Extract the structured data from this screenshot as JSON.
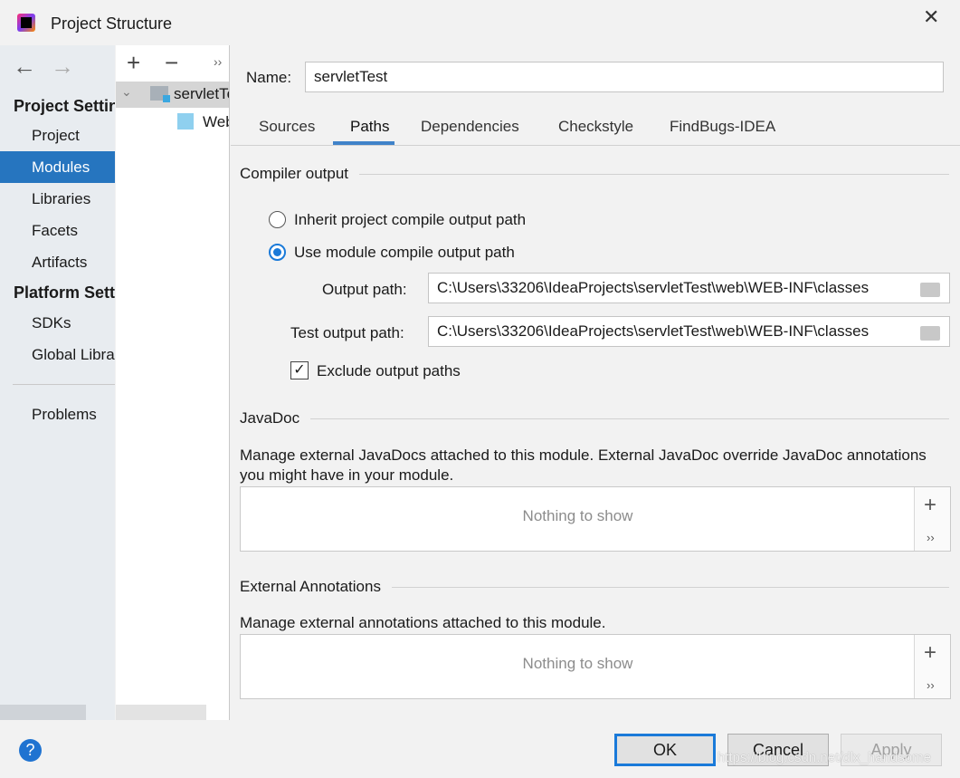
{
  "window": {
    "title": "Project Structure",
    "close_icon": "close-icon"
  },
  "sidebar": {
    "back": "←",
    "forward": "→",
    "section1": "Project Settings",
    "items1": [
      {
        "label": "Project"
      },
      {
        "label": "Modules",
        "selected": true
      },
      {
        "label": "Libraries"
      },
      {
        "label": "Facets"
      },
      {
        "label": "Artifacts"
      }
    ],
    "section2": "Platform Settings",
    "items2": [
      {
        "label": "SDKs"
      },
      {
        "label": "Global Libraries"
      }
    ],
    "problems": "Problems"
  },
  "tree": {
    "add": "+",
    "remove": "−",
    "more": "››",
    "items": [
      {
        "label": "servletTest",
        "expanded": true
      },
      {
        "label": "Web"
      }
    ]
  },
  "main": {
    "name_label": "Name:",
    "name_value": "servletTest",
    "tabs": [
      {
        "label": "Sources"
      },
      {
        "label": "Paths",
        "active": true
      },
      {
        "label": "Dependencies"
      },
      {
        "label": "Checkstyle"
      },
      {
        "label": "FindBugs-IDEA"
      }
    ],
    "compiler": {
      "title": "Compiler output",
      "inherit": "Inherit project compile output path",
      "inherit_selected": false,
      "use_module": "Use module compile output path",
      "use_module_selected": true,
      "output_label": "Output path:",
      "output_value": "C:\\Users\\33206\\IdeaProjects\\servletTest\\web\\WEB-INF\\classes",
      "test_label": "Test output path:",
      "test_value": "C:\\Users\\33206\\IdeaProjects\\servletTest\\web\\WEB-INF\\classes",
      "exclude": "Exclude output paths",
      "exclude_checked": true
    },
    "javadoc": {
      "title": "JavaDoc",
      "desc": "Manage external JavaDocs attached to this module. External JavaDoc override JavaDoc annotations you might have in your module.",
      "empty": "Nothing to show",
      "add": "+",
      "more": "››"
    },
    "annotations": {
      "title": "External Annotations",
      "desc": "Manage external annotations attached to this module.",
      "empty": "Nothing to show",
      "add": "+",
      "more": "››"
    }
  },
  "footer": {
    "help": "?",
    "ok": "OK",
    "cancel": "Cancel",
    "apply": "Apply",
    "watermark": "https://blog.csdn.net/dlx_handsome"
  },
  "colors": {
    "accent": "#2675bf",
    "radio": "#1a7ad9"
  }
}
